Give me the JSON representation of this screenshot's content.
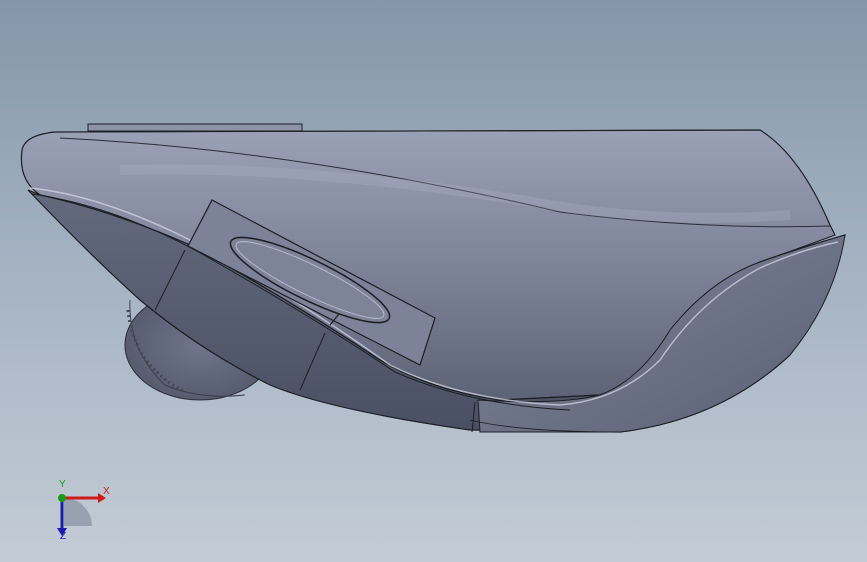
{
  "viewport": {
    "background_top": "#8496aa",
    "background_bottom": "#c3ccd6"
  },
  "model": {
    "icon": "mouse-3d-model",
    "body_color": "#6c7386",
    "edge_color": "#1c1e26"
  },
  "triad": {
    "icon": "coordinate-triad-icon",
    "x_label": "X",
    "y_label": "Y",
    "z_label": "Z",
    "x_color": "#d11a1a",
    "y_color": "#1a9a1a",
    "z_color": "#1a1ab0"
  }
}
